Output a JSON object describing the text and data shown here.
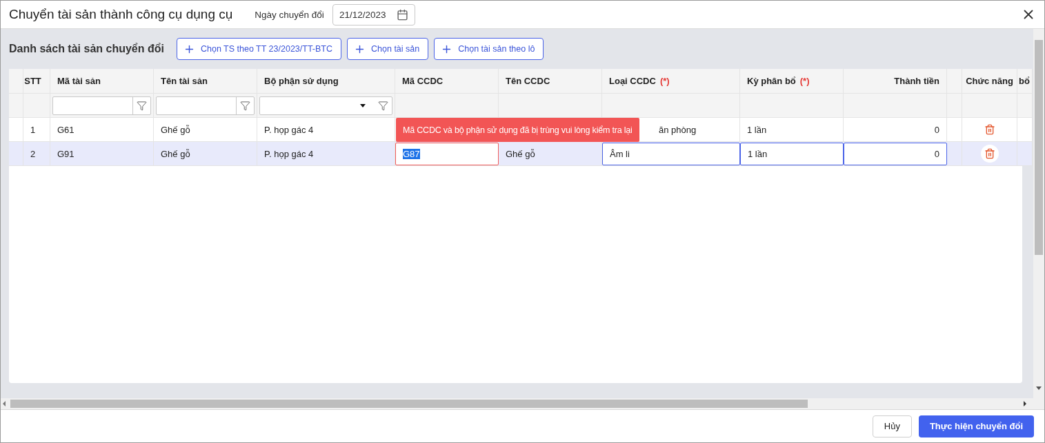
{
  "window": {
    "title": "Chuyển tài sản thành công cụ dụng cụ",
    "date_label": "Ngày chuyển đổi",
    "date_value": "21/12/2023"
  },
  "toolbar": {
    "title": "Danh sách tài sản chuyển đổi",
    "buttons": [
      "Chọn TS theo TT 23/2023/TT-BTC",
      "Chọn tài sản",
      "Chọn tài sản theo lô"
    ]
  },
  "table": {
    "columns": [
      {
        "label": "STT"
      },
      {
        "label": "Mã tài sản"
      },
      {
        "label": "Tên tài sản"
      },
      {
        "label": "Bộ phận sử dụng"
      },
      {
        "label": "Mã CCDC"
      },
      {
        "label": "Tên CCDC"
      },
      {
        "label": "Loại CCDC",
        "required_mark": "(*)"
      },
      {
        "label": "Kỳ phân bổ",
        "required_mark": "(*)"
      },
      {
        "label": "Thành tiền"
      },
      {},
      {
        "label": "Chức năng"
      },
      {
        "label": "bổ"
      }
    ],
    "filters": [
      {
        "kind": "none"
      },
      {
        "kind": "text"
      },
      {
        "kind": "text"
      },
      {
        "kind": "select"
      },
      {
        "kind": "none"
      },
      {
        "kind": "none"
      },
      {
        "kind": "none"
      },
      {
        "kind": "none"
      },
      {
        "kind": "none"
      },
      {
        "kind": "none"
      },
      {
        "kind": "none"
      },
      {
        "kind": "none"
      }
    ],
    "rows": [
      {
        "selected": false,
        "cells": [
          "1",
          "G61",
          "Ghế gỗ",
          "P. họp gác 4",
          null,
          null,
          "ăn phòng",
          "1 lần",
          "0"
        ]
      },
      {
        "selected": true,
        "error": true,
        "text_selected": true,
        "cells": [
          "2",
          "G91",
          "Ghế gỗ",
          "P. họp gác 4",
          "G87",
          "Ghế gỗ",
          "Âm li",
          "1 lần",
          "0"
        ]
      }
    ],
    "error_tooltip": "Mã CCDC và bộ phận sử dụng đã bị trùng vui lòng kiểm tra lại"
  },
  "footer": {
    "buttons": [
      {
        "label": "Hủy",
        "kind": "secondary"
      },
      {
        "label": "Thực hiện chuyển đổi",
        "kind": "primary"
      }
    ]
  }
}
